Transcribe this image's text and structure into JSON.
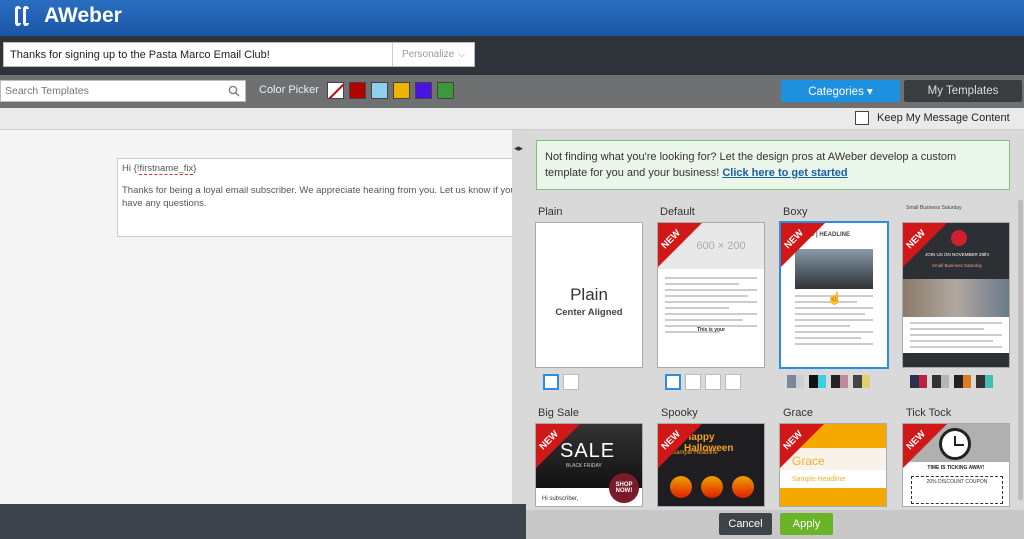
{
  "app": {
    "logo": "AWeber"
  },
  "subject": {
    "value": "Thanks for signing up to the Pasta Marco Email Club!",
    "personalize": "Personalize"
  },
  "toolbar": {
    "search_placeholder": "Search Templates",
    "color_picker_label": "Color Picker",
    "swatches": [
      "#b30000",
      "#8fd0f0",
      "#f0b400",
      "#4a14e0",
      "#3a9a3a"
    ],
    "categories_label": "Categories ▾",
    "my_templates_label": "My Templates"
  },
  "keep": {
    "label": "Keep My Message Content"
  },
  "preview": {
    "greeting_prefix": "Hi {!",
    "greeting_tag": "firstname_fix",
    "greeting_suffix": "}",
    "body": "Thanks for being a loyal email subscriber. We appreciate hearing from you. Let us know if you have any questions."
  },
  "banner": {
    "text": "Not finding what you're looking for? Let the design pros at AWeber develop a custom template for you and your business!",
    "link": "Click here to get started"
  },
  "templates": {
    "plain": {
      "label": "Plain",
      "title": "Plain",
      "subtitle": "Center Aligned"
    },
    "default": {
      "label": "Default",
      "placeholder": "600 × 200",
      "footer_label": "This is your"
    },
    "boxy": {
      "label": "Boxy",
      "header": "GO | HEADLINE"
    },
    "small_business": {
      "caption": "Small Business Saturday",
      "header": "JOIN US ON NOVEMBER 28th!",
      "subheader": "Small Business Saturday"
    },
    "big_sale": {
      "label": "Big Sale",
      "headline": "SALE",
      "sub": "BLACK FRIDAY",
      "badge": "SHOP NOW!",
      "greeting": "Hi subscriber,"
    },
    "spooky": {
      "label": "Spooky",
      "headline": "Happy Halloween",
      "sub": "Sample Headline"
    },
    "grace": {
      "label": "Grace",
      "title": "Grace",
      "sub": "Sample Headline"
    },
    "tick_tock": {
      "label": "Tick Tock",
      "line1": "TIME IS TICKING AWAY!",
      "line2": "20% DISCOUNT COUPON"
    },
    "new_badge": "NEW"
  },
  "footer": {
    "cancel": "Cancel",
    "apply": "Apply"
  }
}
